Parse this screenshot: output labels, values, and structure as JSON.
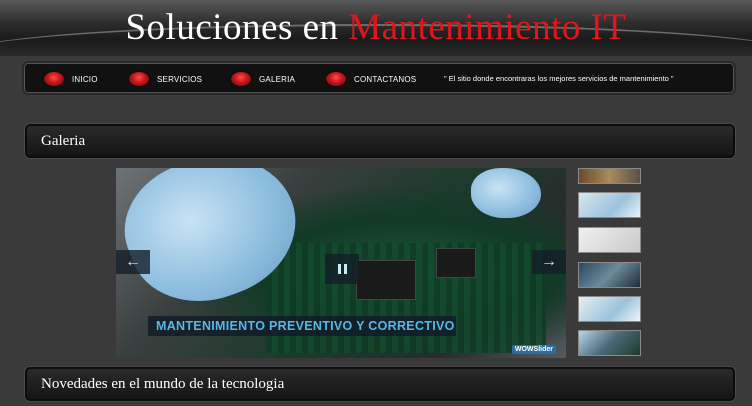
{
  "header": {
    "title_part1": "Soluciones en",
    "title_part2": "Mantenimiento IT"
  },
  "nav": {
    "items": [
      {
        "label": "INICIO"
      },
      {
        "label": "SERVICIOS"
      },
      {
        "label": "GALERIA"
      },
      {
        "label": "CONTACTANOS"
      }
    ],
    "tagline": "\" El sitio donde encontraras los mejores servicios de mantenimiento \""
  },
  "gallery": {
    "title": "Galeria",
    "slider": {
      "caption": "MANTENIMIENTO PREVENTIVO Y CORRECTIVO",
      "badge": "WOWSlider",
      "prev_icon": "arrow-left-icon",
      "next_icon": "arrow-right-icon",
      "pause_icon": "pause-icon"
    },
    "thumbnails": [
      "thumb-1",
      "thumb-2",
      "thumb-3",
      "thumb-4",
      "thumb-5",
      "thumb-6"
    ]
  },
  "news": {
    "title": "Novedades en el mundo de la tecnologia"
  },
  "colors": {
    "accent_red": "#e0161c",
    "caption_blue": "#59b7e6"
  }
}
